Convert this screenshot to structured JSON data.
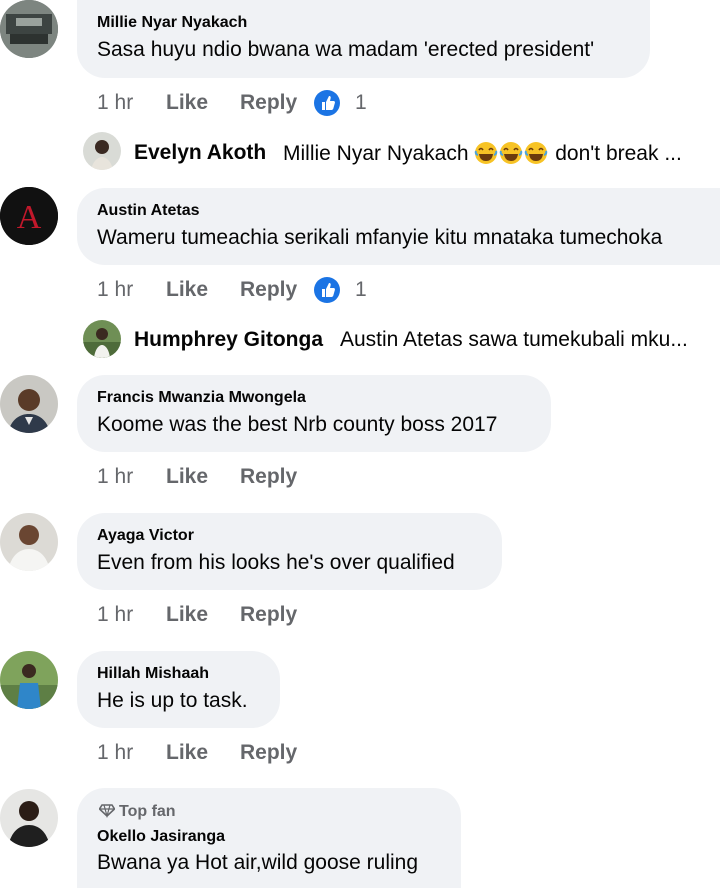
{
  "comments": [
    {
      "author": "Millie Nyar Nyakach",
      "text": "Sasa huyu ndio bwana wa madam 'erected president'",
      "time": "1 hr",
      "like_label": "Like",
      "reply_label": "Reply",
      "reaction_count": "1",
      "reply": {
        "author": "Evelyn Akoth",
        "text_prefix": "Millie Nyar Nyakach",
        "text_suffix": "don't break ..."
      }
    },
    {
      "author": "Austin Atetas",
      "text": "Wameru tumeachia serikali mfanyie kitu mnataka tumechoka",
      "time": "1 hr",
      "like_label": "Like",
      "reply_label": "Reply",
      "reaction_count": "1",
      "avatar_letter": "A",
      "reply": {
        "author": "Humphrey Gitonga",
        "text": "Austin Atetas sawa tumekubali mku..."
      }
    },
    {
      "author": "Francis Mwanzia Mwongela",
      "text": "Koome was the best Nrb county boss 2017",
      "time": "1 hr",
      "like_label": "Like",
      "reply_label": "Reply"
    },
    {
      "author": "Ayaga Victor",
      "text": "Even from his looks he's over qualified",
      "time": "1 hr",
      "like_label": "Like",
      "reply_label": "Reply"
    },
    {
      "author": "Hillah Mishaah",
      "text": "He is up to task.",
      "time": "1 hr",
      "like_label": "Like",
      "reply_label": "Reply"
    },
    {
      "badge": "Top fan",
      "author": "Okello Jasiranga",
      "text": "Bwana ya Hot air,wild goose ruling"
    }
  ],
  "colors": {
    "bubble": "#f0f2f5",
    "meta_text": "#65676b",
    "like_blue": "#1b74e4"
  },
  "icons": [
    "thumbs-up-icon",
    "laughing-emoji-icon",
    "top-fan-diamond-icon"
  ]
}
